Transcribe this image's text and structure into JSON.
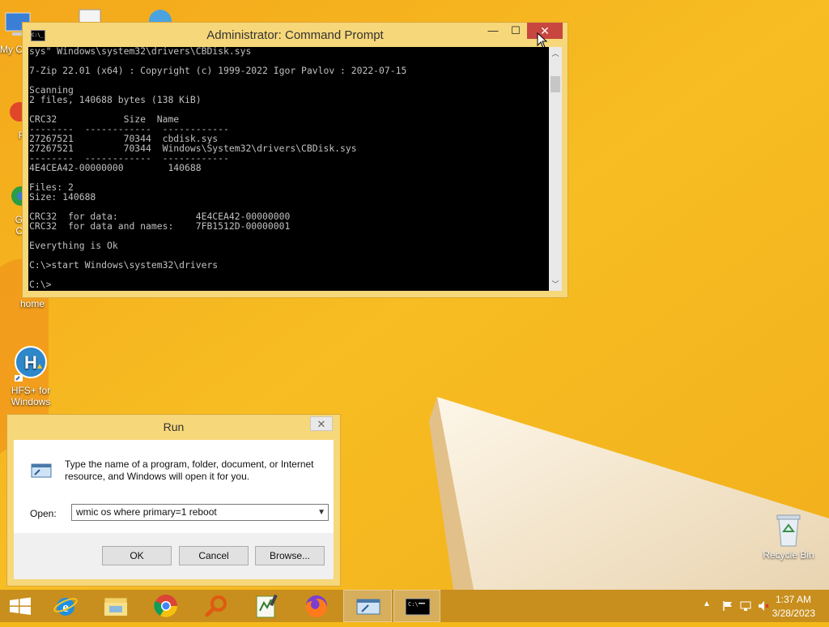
{
  "desktop": {
    "icons": [
      {
        "name": "My C",
        "id": "my-computer"
      },
      {
        "name": "F",
        "id": "f-item"
      },
      {
        "name": "G\nC",
        "id": "google-chrome"
      },
      {
        "name": "home",
        "id": "home"
      },
      {
        "name": "HFS+ for Windows",
        "id": "hfs-for-windows"
      },
      {
        "name": "Recycle Bin",
        "id": "recycle-bin"
      }
    ]
  },
  "cmd": {
    "title": "Administrator:  Command Prompt",
    "lines": [
      "sys\" Windows\\system32\\drivers\\CBDisk.sys",
      "",
      "7-Zip 22.01 (x64) : Copyright (c) 1999-2022 Igor Pavlov : 2022-07-15",
      "",
      "Scanning",
      "2 files, 140688 bytes (138 KiB)",
      "",
      "CRC32            Size  Name",
      "--------  ------------  ------------",
      "27267521         70344  cbdisk.sys",
      "27267521         70344  Windows\\System32\\drivers\\CBDisk.sys",
      "--------  ------------  ------------",
      "4E4CEA42-00000000        140688",
      "",
      "Files: 2",
      "Size: 140688",
      "",
      "CRC32  for data:              4E4CEA42-00000000",
      "CRC32  for data and names:    7FB1512D-00000001",
      "",
      "Everything is Ok",
      "",
      "C:\\>start Windows\\system32\\drivers",
      "",
      "C:\\>"
    ],
    "minimize": "—",
    "maximize": "☐",
    "close": "✕"
  },
  "run": {
    "title": "Run",
    "description": "Type the name of a program, folder, document, or Internet resource, and Windows will open it for you.",
    "open_label": "Open:",
    "open_value": "wmic os where primary=1 reboot",
    "ok": "OK",
    "cancel": "Cancel",
    "browse": "Browse...",
    "close": "✕"
  },
  "taskbar": {
    "apps": [
      "start",
      "internet-explorer",
      "file-explorer",
      "chrome",
      "search-tool",
      "notepad-plus",
      "firefox",
      "run",
      "command-prompt"
    ],
    "active": "command-prompt",
    "time": "1:37 AM",
    "date": "3/28/2023"
  },
  "colors": {
    "wallpaper": "#f5b81a",
    "taskbar": "#c88f1e",
    "window_frame": "#f6d77a",
    "close_red": "#c7463f"
  }
}
